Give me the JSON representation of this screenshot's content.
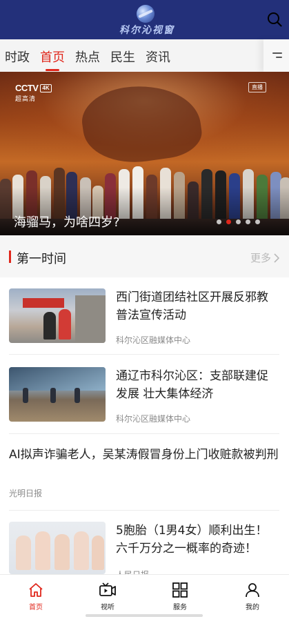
{
  "header": {
    "logo_text": "科尔沁视窗",
    "search_icon": "search-icon"
  },
  "tabs": [
    {
      "label": "时政",
      "active": false
    },
    {
      "label": "首页",
      "active": true
    },
    {
      "label": "热点",
      "active": false
    },
    {
      "label": "民生",
      "active": false
    },
    {
      "label": "资讯",
      "active": false
    }
  ],
  "tab_menu_icon": "menu-lines-icon",
  "banner": {
    "channel_logo": "CCTV",
    "channel_badge": "4K",
    "channel_sub": "超高清",
    "live_label": "直播",
    "caption": "海骝马，为啥四岁?",
    "slide_count": 5,
    "active_slide": 2
  },
  "section": {
    "title": "第一时间",
    "more_label": "更多"
  },
  "news": [
    {
      "title": "西门街道团结社区开展反邪教普法宣传活动",
      "source": "科尔沁区融媒体中心",
      "has_image": true
    },
    {
      "title": "通辽市科尔沁区：支部联建促发展 壮大集体经济",
      "source": "科尔沁区融媒体中心",
      "has_image": true
    },
    {
      "title": "AI拟声诈骗老人，吴某涛假冒身份上门收赃款被判刑",
      "source": "光明日报",
      "has_image": false
    },
    {
      "title": "5胞胎（1男4女）顺利出生！六千万分之一概率的奇迹！",
      "source": "人民日报",
      "has_image": true
    }
  ],
  "bottom_nav": [
    {
      "label": "首页",
      "icon": "home-icon",
      "active": true
    },
    {
      "label": "视听",
      "icon": "video-icon",
      "active": false
    },
    {
      "label": "服务",
      "icon": "grid-icon",
      "active": false
    },
    {
      "label": "我的",
      "icon": "user-icon",
      "active": false
    }
  ],
  "colors": {
    "header_bg": "#23307a",
    "accent": "#e0271c"
  }
}
